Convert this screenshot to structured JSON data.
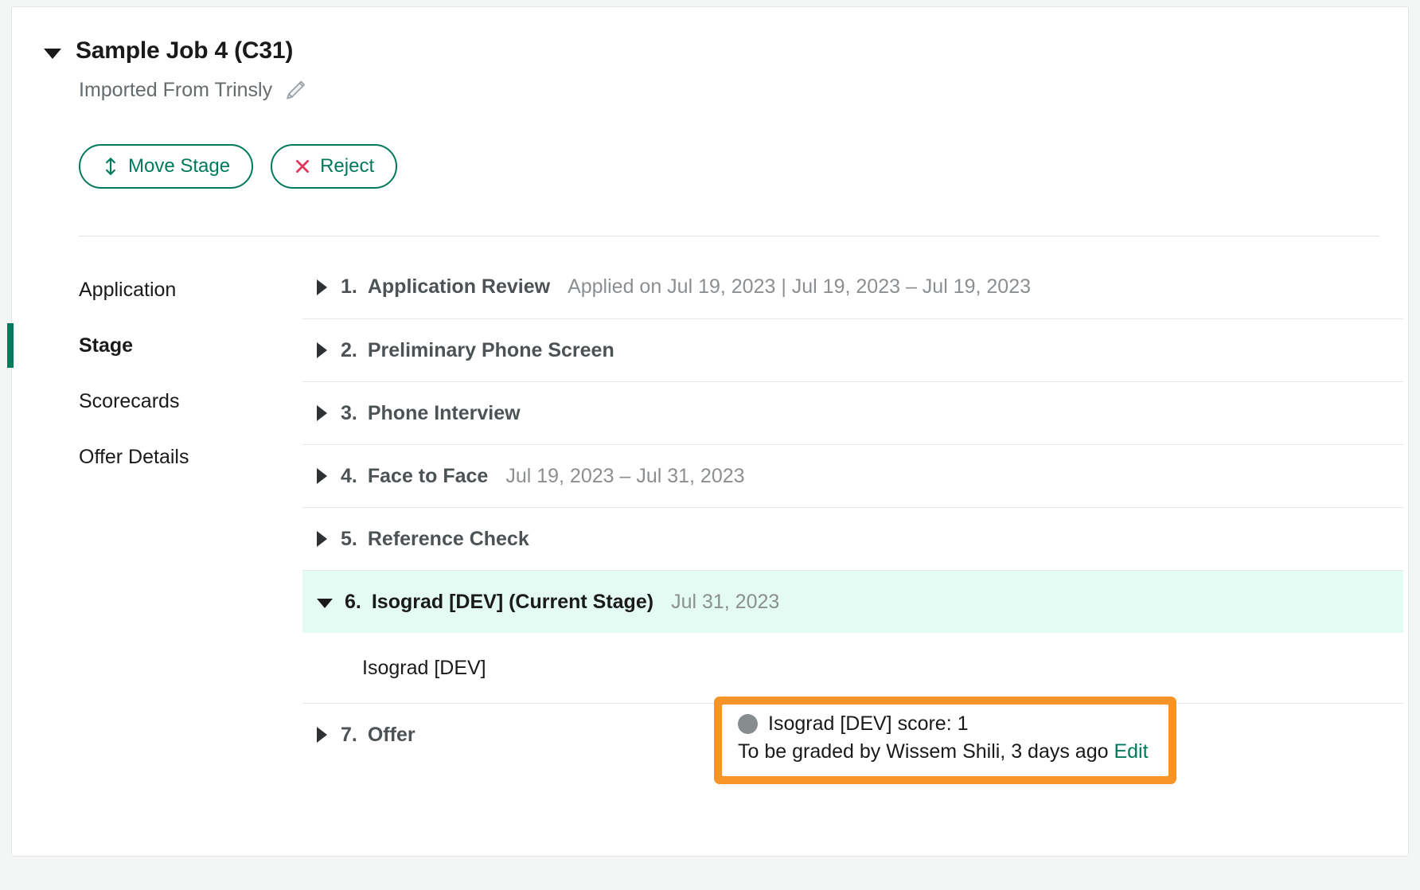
{
  "header": {
    "job_title": "Sample Job 4 (C31)",
    "subtitle": "Imported From Trinsly",
    "edit_icon": "pencil-icon",
    "collapse_icon": "caret-down-icon"
  },
  "actions": {
    "move_stage": {
      "label": "Move Stage",
      "icon": "move-vertical-icon",
      "color": "#00795c"
    },
    "reject": {
      "label": "Reject",
      "icon": "close-x-icon",
      "icon_color": "#e03a5c",
      "color": "#00795c"
    }
  },
  "sidebar": {
    "items": [
      {
        "label": "Application",
        "active": false
      },
      {
        "label": "Stage",
        "active": true
      },
      {
        "label": "Scorecards",
        "active": false
      },
      {
        "label": "Offer Details",
        "active": false
      }
    ],
    "active_indicator_color": "#00795c"
  },
  "stages": [
    {
      "number": "1.",
      "name": "Application Review",
      "meta": "Applied on Jul 19, 2023 | Jul 19, 2023 – Jul 19, 2023",
      "expanded": false,
      "current": false
    },
    {
      "number": "2.",
      "name": "Preliminary Phone Screen",
      "meta": "",
      "expanded": false,
      "current": false
    },
    {
      "number": "3.",
      "name": "Phone Interview",
      "meta": "",
      "expanded": false,
      "current": false
    },
    {
      "number": "4.",
      "name": "Face to Face",
      "meta": "Jul 19, 2023 – Jul 31, 2023",
      "expanded": false,
      "current": false
    },
    {
      "number": "5.",
      "name": "Reference Check",
      "meta": "",
      "expanded": false,
      "current": false
    },
    {
      "number": "6.",
      "name": "Isograd [DEV] (Current Stage)",
      "meta": "Jul 31, 2023",
      "expanded": true,
      "current": true
    },
    {
      "number": "7.",
      "name": "Offer",
      "meta": "",
      "expanded": false,
      "current": false
    }
  ],
  "current_stage_detail": {
    "interview_label": "Isograd [DEV]"
  },
  "callout": {
    "border_color": "#f79327",
    "score_line": "Isograd [DEV] score: 1",
    "status_line": "To be graded by Wissem Shili, 3 days ago",
    "edit_label": "Edit",
    "edit_color": "#00795c",
    "dot_color": "#878c8f"
  }
}
